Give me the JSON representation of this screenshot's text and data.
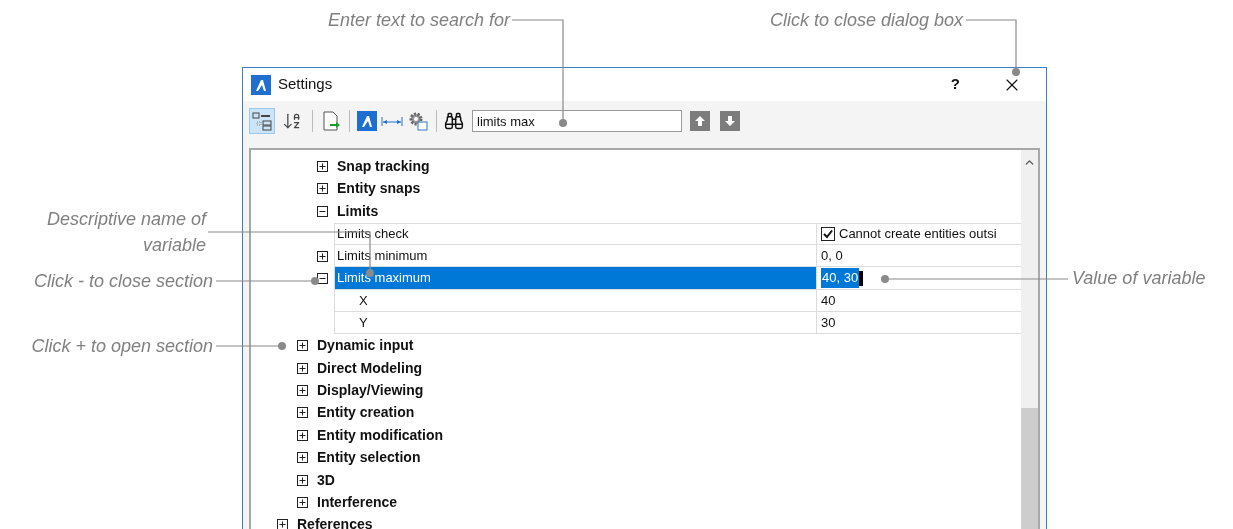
{
  "callouts": [
    {
      "text": "Enter text to search for"
    },
    {
      "text": "Click to close dialog box"
    },
    {
      "text": "Descriptive name of variable"
    },
    {
      "text": "Click - to close section"
    },
    {
      "text": "Click + to open section"
    },
    {
      "text": "Value of variable"
    }
  ],
  "window": {
    "title": "Settings",
    "help": "?"
  },
  "toolbar": {
    "view_buttons": [
      {
        "kind": "categorized",
        "selected": true
      },
      {
        "kind": "alphabetical",
        "selected": false
      }
    ],
    "search": {
      "value": "limits max"
    }
  },
  "tree": {
    "subsections": [
      {
        "label": "Snap tracking",
        "expanded": false
      },
      {
        "label": "Entity snaps",
        "expanded": false
      },
      {
        "label": "Limits",
        "expanded": true,
        "properties": [
          {
            "name": "Limits check",
            "kind": "checkbox",
            "checked": true,
            "value": "Cannot create entities outsi",
            "selected": false
          },
          {
            "name": "Limits minimum",
            "kind": "text",
            "expanded": false,
            "value": "0, 0",
            "selected": false
          },
          {
            "name": "Limits maximum",
            "kind": "text",
            "expanded": true,
            "value": "40, 30",
            "selected": true,
            "children": [
              {
                "name": "X",
                "value": "40",
                "selected": false
              },
              {
                "name": "Y",
                "value": "30",
                "selected": false
              }
            ]
          }
        ]
      }
    ],
    "sections": [
      {
        "label": "Dynamic input",
        "expanded": false
      },
      {
        "label": "Direct Modeling",
        "expanded": false
      },
      {
        "label": "Display/Viewing",
        "expanded": false
      },
      {
        "label": "Entity creation",
        "expanded": false
      },
      {
        "label": "Entity modification",
        "expanded": false
      },
      {
        "label": "Entity selection",
        "expanded": false
      },
      {
        "label": "3D",
        "expanded": false
      },
      {
        "label": "Interference",
        "expanded": false
      }
    ],
    "categories": [
      {
        "label": "References",
        "expanded": false
      }
    ]
  }
}
